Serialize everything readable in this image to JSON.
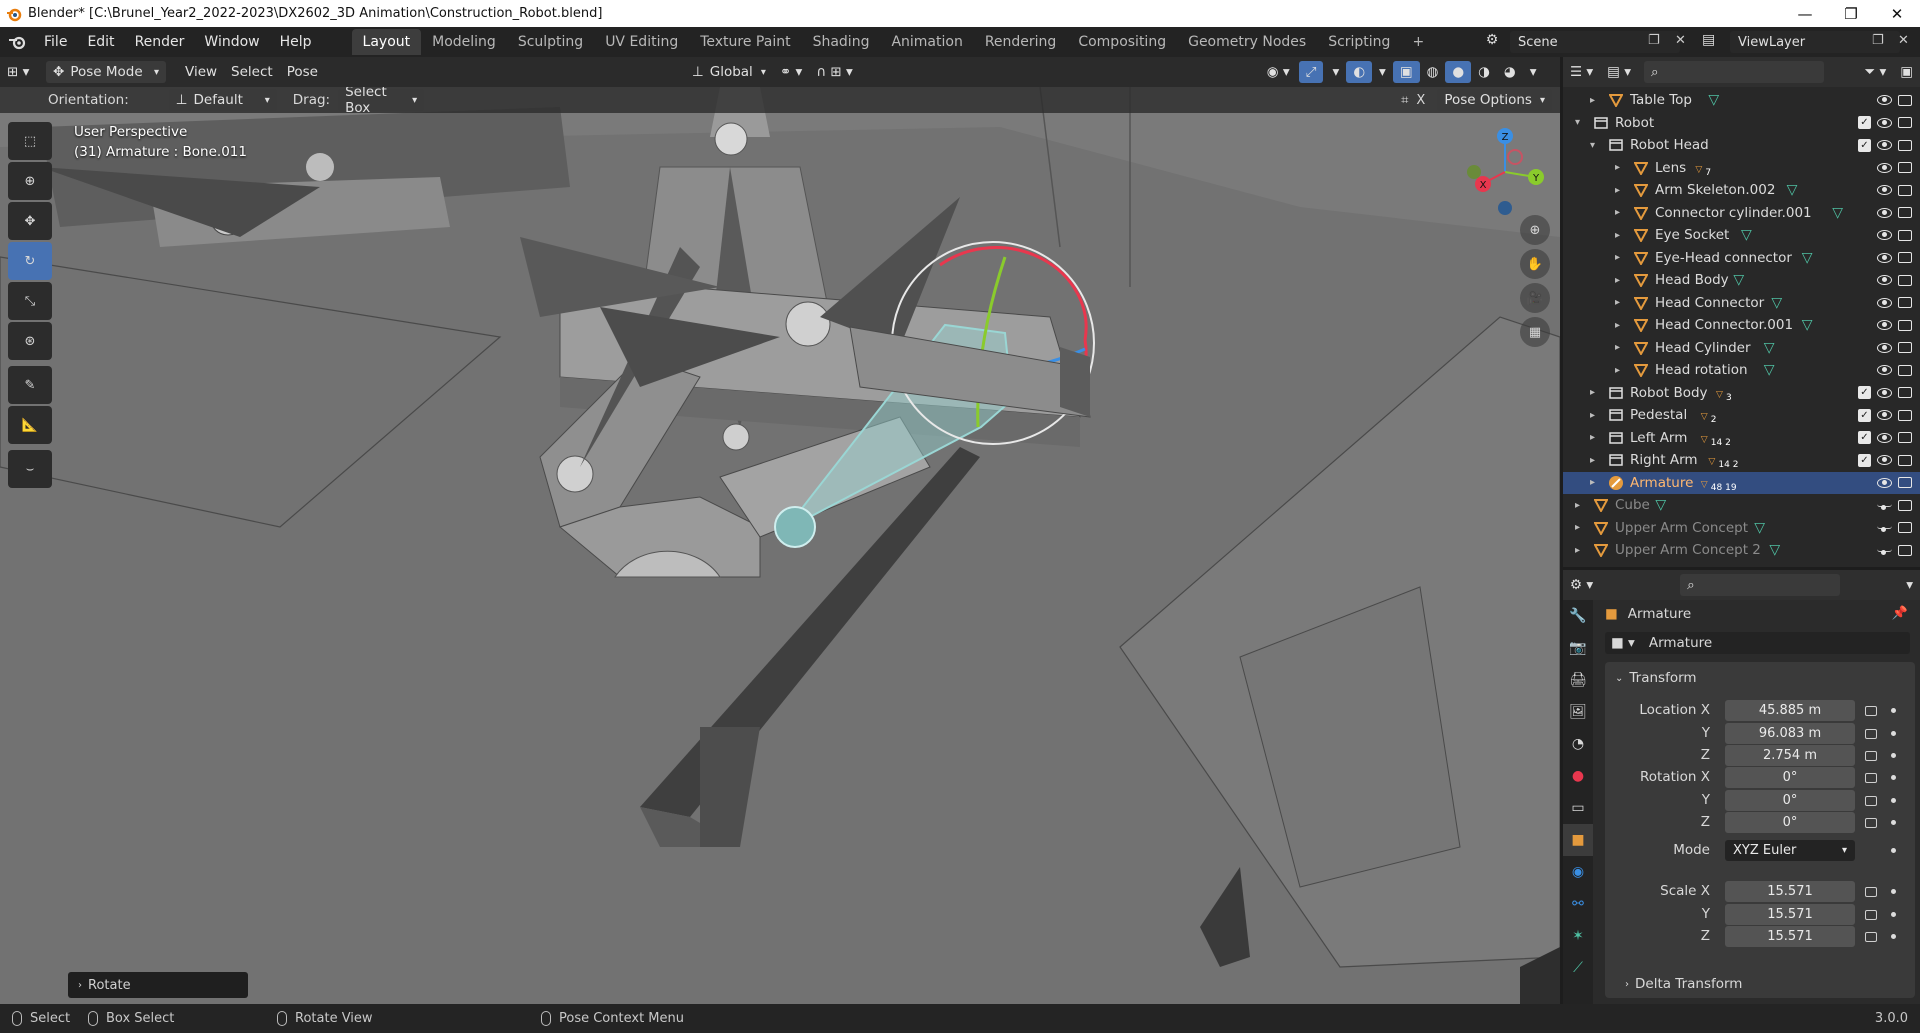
{
  "window": {
    "title": "Blender* [C:\\Brunel_Year2_2022-2023\\DX2602_3D Animation\\Construction_Robot.blend]",
    "controls": [
      "—",
      "❐",
      "✕"
    ]
  },
  "menu": {
    "items": [
      "File",
      "Edit",
      "Render",
      "Window",
      "Help"
    ],
    "workspaces": [
      "Layout",
      "Modeling",
      "Sculpting",
      "UV Editing",
      "Texture Paint",
      "Shading",
      "Animation",
      "Rendering",
      "Compositing",
      "Geometry Nodes",
      "Scripting"
    ],
    "add_tab": "+",
    "scene": "Scene",
    "view_layer": "ViewLayer"
  },
  "viewport_header": {
    "mode": "Pose Mode",
    "menus": [
      "View",
      "Select",
      "Pose"
    ],
    "transform_orientation": "Global"
  },
  "tool_header": {
    "orientation_label": "Orientation:",
    "orientation_value": "Default",
    "drag_label": "Drag:",
    "drag_value": "Select Box",
    "pose_options": "Pose Options",
    "close_x": "X"
  },
  "viewport": {
    "perspective": "User Perspective",
    "active": "(31) Armature : Bone.011",
    "gizmo_axes": [
      "X",
      "Y",
      "Z"
    ]
  },
  "last_operator": "Rotate",
  "statusbar": {
    "select": "Select",
    "box_select": "Box Select",
    "rotate_view": "Rotate View",
    "context_menu": "Pose Context Menu",
    "version": "3.0.0"
  },
  "outliner": {
    "rows": [
      {
        "label": "Table Top",
        "type": "object",
        "depth": 1,
        "badge": ""
      },
      {
        "label": "Robot",
        "type": "collection",
        "depth": 0,
        "badge": ""
      },
      {
        "label": "Robot Head",
        "type": "collection",
        "depth": 1,
        "badge": ""
      },
      {
        "label": "Lens",
        "type": "object",
        "depth": 2,
        "badge": "7"
      },
      {
        "label": "Arm Skeleton.002",
        "type": "object",
        "depth": 2,
        "badge": ""
      },
      {
        "label": "Connector cylinder.001",
        "type": "object",
        "depth": 2,
        "badge": ""
      },
      {
        "label": "Eye Socket",
        "type": "object",
        "depth": 2,
        "badge": ""
      },
      {
        "label": "Eye-Head connector",
        "type": "object",
        "depth": 2,
        "badge": ""
      },
      {
        "label": "Head Body",
        "type": "object",
        "depth": 2,
        "badge": ""
      },
      {
        "label": "Head Connector",
        "type": "object",
        "depth": 2,
        "badge": ""
      },
      {
        "label": "Head Connector.001",
        "type": "object",
        "depth": 2,
        "badge": ""
      },
      {
        "label": "Head Cylinder",
        "type": "object",
        "depth": 2,
        "badge": ""
      },
      {
        "label": "Head rotation",
        "type": "object",
        "depth": 2,
        "badge": ""
      },
      {
        "label": "Robot Body",
        "type": "collection",
        "depth": 1,
        "badge": "3"
      },
      {
        "label": "Pedestal",
        "type": "collection",
        "depth": 1,
        "badge": "2"
      },
      {
        "label": "Left Arm",
        "type": "collection",
        "depth": 1,
        "badge": "14 2"
      },
      {
        "label": "Right Arm",
        "type": "collection",
        "depth": 1,
        "badge": "14 2"
      },
      {
        "label": "Armature",
        "type": "armature",
        "depth": 1,
        "badge": "48 19"
      },
      {
        "label": "Cube",
        "type": "object",
        "depth": 0,
        "badge": ""
      },
      {
        "label": "Upper Arm Concept",
        "type": "object",
        "depth": 0,
        "badge": ""
      },
      {
        "label": "Upper Arm Concept 2",
        "type": "object",
        "depth": 0,
        "badge": ""
      }
    ]
  },
  "properties": {
    "object_name": "Armature",
    "data_name": "Armature",
    "panel": "Transform",
    "location_label": "Location X",
    "location": [
      "45.885 m",
      "96.083 m",
      "2.754 m"
    ],
    "rotation_label": "Rotation X",
    "rotation": [
      "0°",
      "0°",
      "0°"
    ],
    "mode_label": "Mode",
    "mode": "XYZ Euler",
    "scale_label": "Scale X",
    "scale": [
      "15.571",
      "15.571",
      "15.571"
    ],
    "axis_y": "Y",
    "axis_z": "Z",
    "delta": "Delta Transform"
  },
  "colors": {
    "accent": "#4772b3",
    "selection": "#334d80",
    "bone": "#9ad6d4",
    "mesh_icon": "#4fc1a3",
    "object_icon": "#e49a3d",
    "axis_x": "#e8374e",
    "axis_y": "#8acb2c",
    "axis_z": "#3a8fe4"
  }
}
